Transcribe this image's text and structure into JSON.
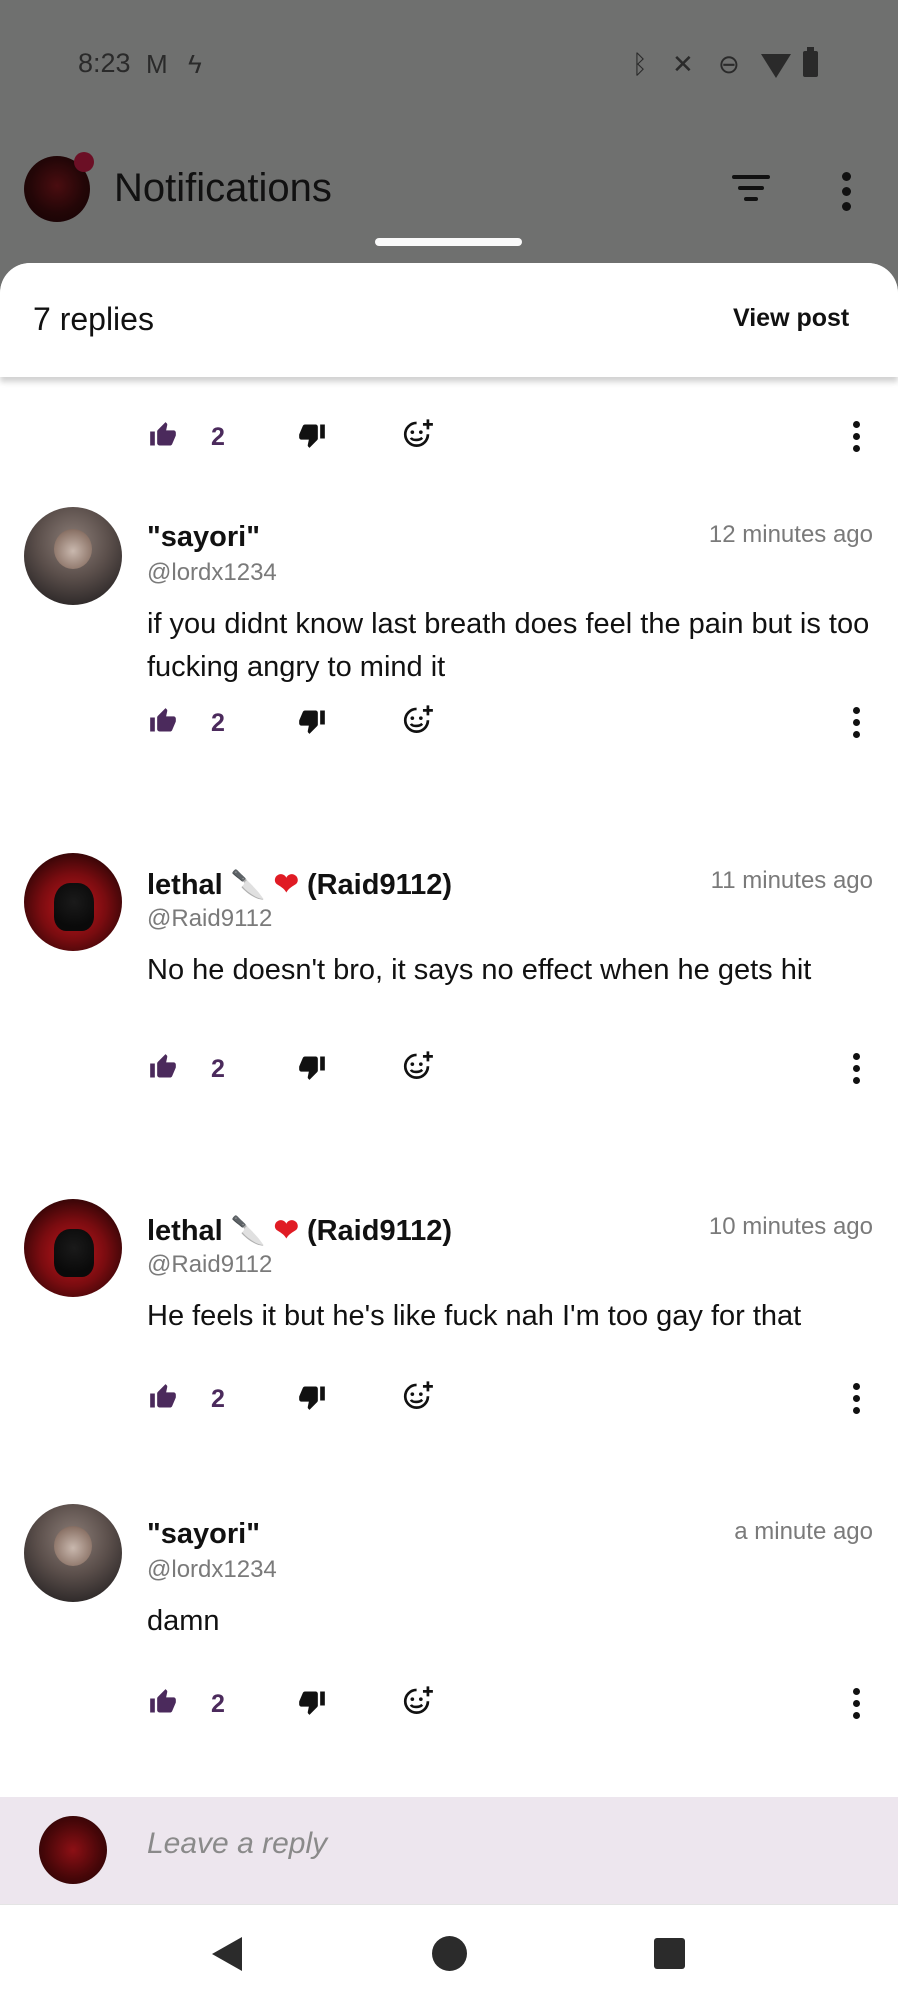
{
  "status_bar": {
    "time": "8:23",
    "icons": [
      "gmail-icon",
      "lightning-icon",
      "bluetooth-icon",
      "mute-icon",
      "do-not-disturb-icon",
      "wifi-icon",
      "battery-icon"
    ]
  },
  "header": {
    "title": "Notifications"
  },
  "sheet": {
    "replies_count": "7 replies",
    "view_post": "View post"
  },
  "first_actions": {
    "likes": "2"
  },
  "comments": [
    {
      "display_name": "\"sayori\"",
      "username": "@lordx1234",
      "time": "12 minutes ago",
      "text": "if you didnt know last breath does feel the pain but is too fucking angry to mind it",
      "likes": "2"
    },
    {
      "display_name_prefix": "lethal",
      "knife_emoji": "🔪",
      "heart_emoji": "❤",
      "display_name_suffix": "(Raid9112)",
      "username": "@Raid9112",
      "time": "11 minutes ago",
      "text": "No he doesn't bro, it says no effect when he gets hit",
      "likes": "2"
    },
    {
      "display_name_prefix": "lethal",
      "knife_emoji": "🔪",
      "heart_emoji": "❤",
      "display_name_suffix": "(Raid9112)",
      "username": "@Raid9112",
      "time": "10 minutes ago",
      "text": "He feels it but he's like fuck nah I'm too gay for that",
      "likes": "2"
    },
    {
      "display_name": "\"sayori\"",
      "username": "@lordx1234",
      "time": "a minute ago",
      "text": "damn",
      "likes": "2"
    }
  ],
  "reply": {
    "placeholder": "Leave a reply"
  },
  "colors": {
    "like_accent": "#4b2a5c",
    "reply_bar_bg": "#ede6ee",
    "scrim": "#6f706f"
  }
}
